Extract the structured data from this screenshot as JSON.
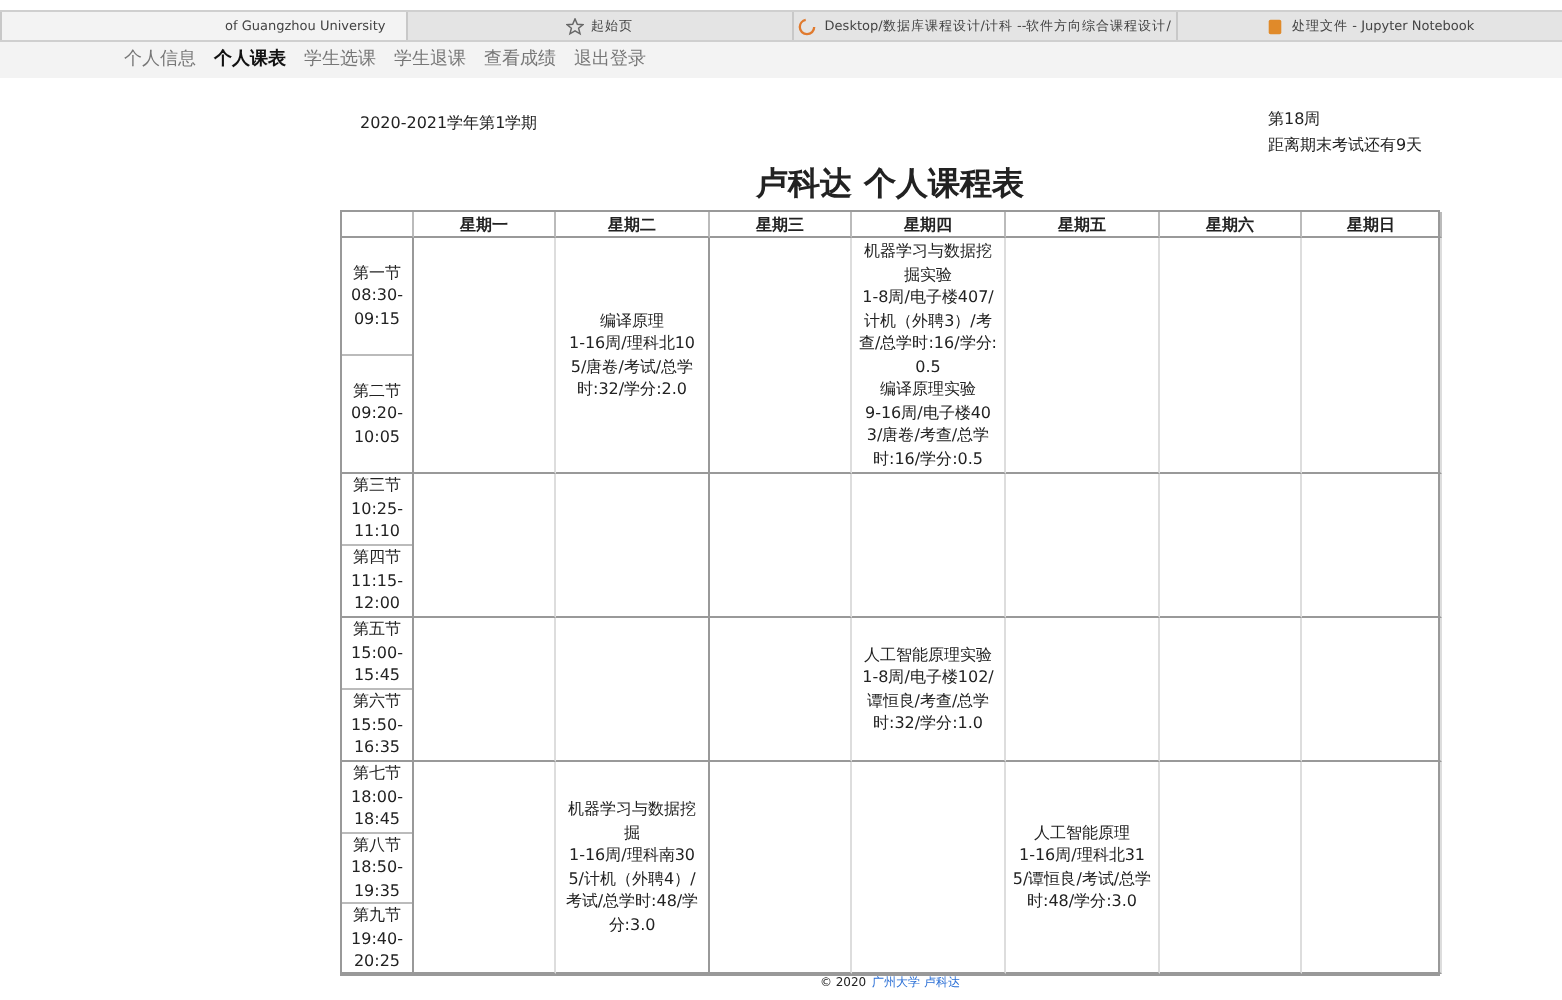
{
  "browser_tabs": [
    {
      "title": "of Guangzhou University",
      "selected": true
    },
    {
      "title": "起始页",
      "selected": false
    },
    {
      "title": "Desktop/数据库课程设计/计科 --软件方向综合课程设计/",
      "selected": false
    },
    {
      "title": "处理文件 - Jupyter Notebook",
      "selected": false
    }
  ],
  "nav": [
    {
      "label": "个人信息",
      "selected": false
    },
    {
      "label": "个人课表",
      "selected": true
    },
    {
      "label": "学生选课",
      "selected": false
    },
    {
      "label": "学生退课",
      "selected": false
    },
    {
      "label": "查看成绩",
      "selected": false
    },
    {
      "label": "退出登录",
      "selected": false
    }
  ],
  "term": "2020-2021学年第1学期",
  "week": "第18周",
  "countdown": "距离期末考试还有9天",
  "title": "卢科达 个人课程表",
  "days": [
    "星期一",
    "星期二",
    "星期三",
    "星期四",
    "星期五",
    "星期六",
    "星期日"
  ],
  "periods": [
    {
      "slots": [
        {
          "name": "第一节",
          "start": "08:30-",
          "end": "09:15"
        },
        {
          "name": "第二节",
          "start": "09:20-",
          "end": "10:05"
        }
      ],
      "cells": [
        [],
        [
          {
            "name": "编译原理",
            "detail": "1-16周/理科北105/唐卷/考试/总学时:32/学分:2.0"
          }
        ],
        [],
        [
          {
            "name": "机器学习与数据挖掘实验",
            "detail": "1-8周/电子楼407/计机（外聘3）/考查/总学时:16/学分:0.5"
          },
          {
            "name": "编译原理实验",
            "detail": "9-16周/电子楼403/唐卷/考查/总学时:16/学分:0.5"
          }
        ],
        [],
        [],
        []
      ]
    },
    {
      "slots": [
        {
          "name": "第三节",
          "start": "10:25-",
          "end": "11:10"
        },
        {
          "name": "第四节",
          "start": "11:15-",
          "end": "12:00"
        }
      ],
      "cells": [
        [],
        [],
        [],
        [],
        [],
        [],
        []
      ]
    },
    {
      "slots": [
        {
          "name": "第五节",
          "start": "15:00-",
          "end": "15:45"
        },
        {
          "name": "第六节",
          "start": "15:50-",
          "end": "16:35"
        }
      ],
      "cells": [
        [],
        [],
        [],
        [
          {
            "name": "人工智能原理实验",
            "detail": "1-8周/电子楼102/谭恒良/考查/总学时:32/学分:1.0"
          }
        ],
        [],
        [],
        []
      ]
    },
    {
      "slots": [
        {
          "name": "第七节",
          "start": "18:00-",
          "end": "18:45"
        },
        {
          "name": "第八节",
          "start": "18:50-",
          "end": "19:35"
        },
        {
          "name": "第九节",
          "start": "19:40-",
          "end": "20:25"
        }
      ],
      "cells": [
        [],
        [
          {
            "name": "机器学习与数据挖掘",
            "detail": "1-16周/理科南305/计机（外聘4）/考试/总学时:48/学分:3.0"
          }
        ],
        [],
        [],
        [
          {
            "name": "人工智能原理",
            "detail": "1-16周/理科北315/谭恒良/考试/总学时:48/学分:3.0"
          }
        ],
        [],
        []
      ]
    }
  ],
  "footer": {
    "text": "© 2020",
    "link": "广州大学 卢科达"
  }
}
